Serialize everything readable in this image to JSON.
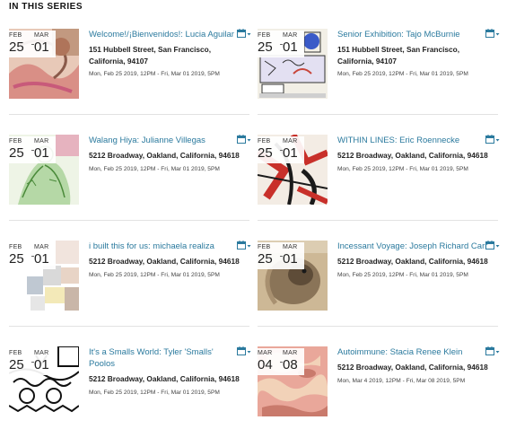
{
  "section": {
    "heading": "IN THIS SERIES"
  },
  "colors": {
    "link": "#2b7a9e",
    "text": "#222222",
    "muted": "#444444"
  },
  "events": [
    {
      "start_month": "FEB",
      "start_day": "25",
      "end_month": "MAR",
      "end_day": "01",
      "title": "Welcome!/¡Bienvenidos!: Lucia Aguilar",
      "address": "151 Hubbell Street, San Francisco, California, 94107",
      "dates": "Mon, Feb 25 2019, 12PM - Fri, Mar 01 2019, 5PM",
      "image": "pink-swirl-painting",
      "calendar_icon": "calendar-add-icon"
    },
    {
      "start_month": "FEB",
      "start_day": "25",
      "end_month": "MAR",
      "end_day": "01",
      "title": "Senior Exhibition: Tajo McBurnie",
      "address": "151 Hubbell Street, San Francisco, California, 94107",
      "dates": "Mon, Feb 25 2019, 12PM - Fri, Mar 01 2019, 5PM",
      "image": "comic-poster",
      "calendar_icon": "calendar-add-icon"
    },
    {
      "start_month": "FEB",
      "start_day": "25",
      "end_month": "MAR",
      "end_day": "01",
      "title": "Walang Hiya: Julianne Villegas",
      "address": "5212 Broadway, Oakland, California, 94618",
      "dates": "Mon, Feb 25 2019, 12PM - Fri, Mar 01 2019, 5PM",
      "image": "green-figure-drawing",
      "calendar_icon": "calendar-add-icon"
    },
    {
      "start_month": "FEB",
      "start_day": "25",
      "end_month": "MAR",
      "end_day": "01",
      "title": "WITHIN LINES: Eric Roennecke",
      "address": "5212 Broadway, Oakland, California, 94618",
      "dates": "Mon, Feb 25 2019, 12PM - Fri, Mar 01 2019, 5PM",
      "image": "red-black-abstract",
      "calendar_icon": "calendar-add-icon"
    },
    {
      "start_month": "FEB",
      "start_day": "25",
      "end_month": "MAR",
      "end_day": "01",
      "title": "i built this for us: michaela realiza",
      "address": "5212 Broadway, Oakland, California, 94618",
      "dates": "Mon, Feb 25 2019, 12PM - Fri, Mar 01 2019, 5PM",
      "image": "collage-squares",
      "calendar_icon": "calendar-add-icon"
    },
    {
      "start_month": "FEB",
      "start_day": "25",
      "end_month": "MAR",
      "end_day": "01",
      "title": "Incessant Voyage: Joseph Richard Carr",
      "address": "5212 Broadway, Oakland, California, 94618",
      "dates": "Mon, Feb 25 2019, 12PM - Fri, Mar 01 2019, 5PM",
      "image": "sepia-animal-photo",
      "calendar_icon": "calendar-add-icon"
    },
    {
      "start_month": "FEB",
      "start_day": "25",
      "end_month": "MAR",
      "end_day": "01",
      "title": "It's a Smalls World: Tyler 'Smalls' Poolos",
      "address": "5212 Broadway, Oakland, California, 94618",
      "dates": "Mon, Feb 25 2019, 12PM - Fri, Mar 01 2019, 5PM",
      "image": "black-white-cartoon",
      "calendar_icon": "calendar-add-icon"
    },
    {
      "start_month": "MAR",
      "start_day": "04",
      "end_month": "MAR",
      "end_day": "08",
      "title": "Autoimmune: Stacia Renee Klein",
      "address": "5212 Broadway, Oakland, California, 94618",
      "dates": "Mon, Mar 4 2019, 12PM - Fri, Mar 08 2019, 5PM",
      "image": "pink-camouflage-pattern",
      "calendar_icon": "calendar-add-icon"
    }
  ]
}
